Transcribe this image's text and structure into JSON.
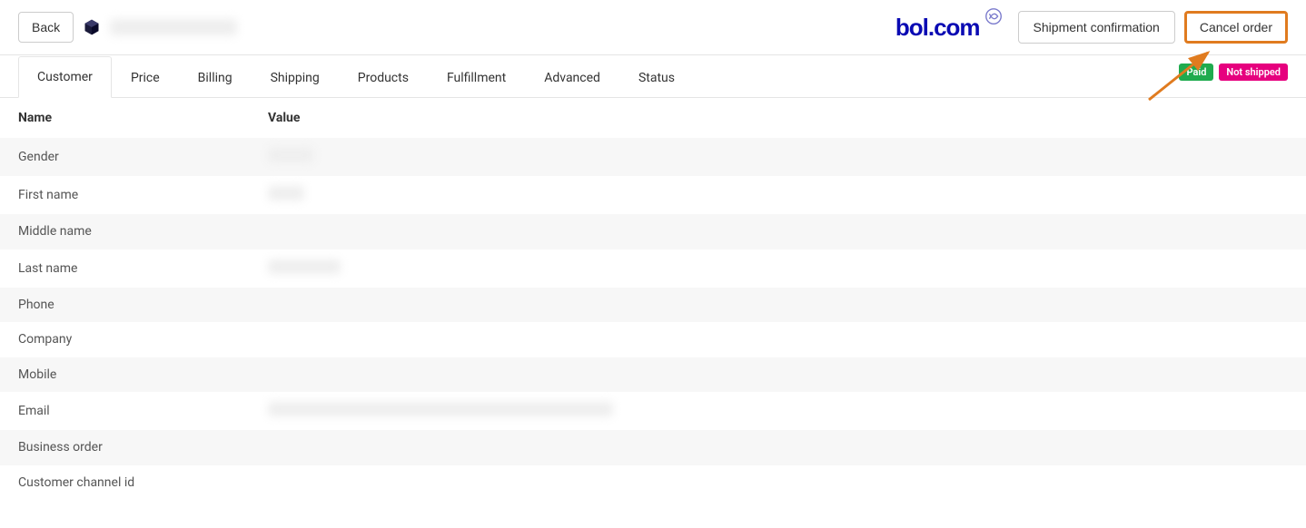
{
  "header": {
    "back_label": "Back",
    "order_id_placeholder": "",
    "shipment_confirmation_label": "Shipment confirmation",
    "cancel_order_label": "Cancel order",
    "brand_text": "bol.com"
  },
  "tabs": [
    {
      "label": "Customer",
      "active": true
    },
    {
      "label": "Price",
      "active": false
    },
    {
      "label": "Billing",
      "active": false
    },
    {
      "label": "Shipping",
      "active": false
    },
    {
      "label": "Products",
      "active": false
    },
    {
      "label": "Fulfillment",
      "active": false
    },
    {
      "label": "Advanced",
      "active": false
    },
    {
      "label": "Status",
      "active": false
    }
  ],
  "badges": {
    "paid": "Paid",
    "not_shipped": "Not shipped"
  },
  "table": {
    "columns": {
      "name": "Name",
      "value": "Value"
    },
    "rows": [
      {
        "name": "Gender",
        "value": "",
        "blurred": true,
        "blur_w": 50
      },
      {
        "name": "First name",
        "value": "",
        "blurred": true,
        "blur_w": 40
      },
      {
        "name": "Middle name",
        "value": "",
        "blurred": false
      },
      {
        "name": "Last name",
        "value": "",
        "blurred": true,
        "blur_w": 80
      },
      {
        "name": "Phone",
        "value": "",
        "blurred": false
      },
      {
        "name": "Company",
        "value": "",
        "blurred": false
      },
      {
        "name": "Mobile",
        "value": "",
        "blurred": false
      },
      {
        "name": "Email",
        "value": "",
        "blurred": true,
        "blur_w": 380
      },
      {
        "name": "Business order",
        "value": "",
        "blurred": false
      },
      {
        "name": "Customer channel id",
        "value": "",
        "blurred": false
      }
    ]
  }
}
